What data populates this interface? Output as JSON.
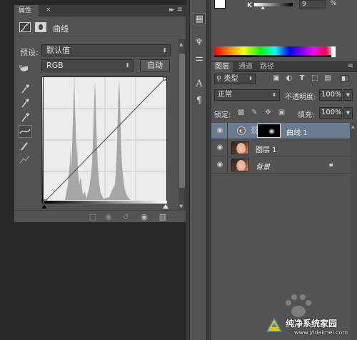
{
  "properties_panel": {
    "tab_label": "属性",
    "tab_close": "×",
    "collapse": "▸▸",
    "menu": "≡",
    "adjustment_title": "曲线",
    "preset_label": "预设:",
    "preset_value": "默认值",
    "channel_value": "RGB",
    "auto_label": "自动",
    "footer_icons": [
      "clip-to-layer-icon",
      "view-previous-icon",
      "reset-icon",
      "visibility-icon",
      "delete-icon"
    ]
  },
  "swatches": {
    "foreground": "#ffffff",
    "background": "#000000"
  },
  "color_panel": {
    "channel_label": "K",
    "value": "9",
    "unit": "%"
  },
  "layers_panel": {
    "tabs": [
      "图层",
      "通道",
      "路径"
    ],
    "menu": "≡",
    "filter_kind": "类型",
    "blend_mode": "正常",
    "opacity_label": "不透明度:",
    "opacity_value": "100%",
    "lock_label": "锁定:",
    "fill_label": "填充:",
    "fill_value": "100%",
    "layers": [
      {
        "name": "曲线 1",
        "type": "adjustment",
        "selected": true
      },
      {
        "name": "图层 1",
        "type": "pixel",
        "selected": false
      },
      {
        "name": "背景",
        "type": "background",
        "selected": false,
        "locked": true
      }
    ]
  },
  "watermark": {
    "text": "纯净系统家园",
    "url": "www.yidaimei.com"
  }
}
